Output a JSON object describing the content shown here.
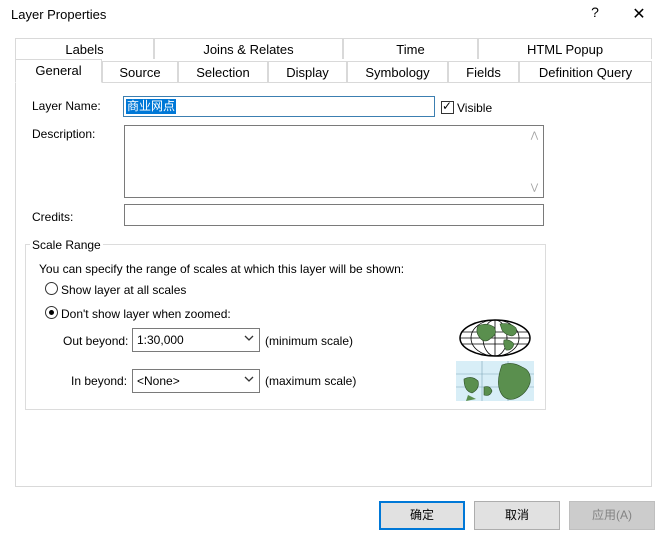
{
  "window": {
    "title": "Layer Properties",
    "help_glyph": "?",
    "close_glyph": "✕"
  },
  "tabs_row1": [
    "Labels",
    "Joins & Relates",
    "Time",
    "HTML Popup"
  ],
  "tabs_row2": [
    "General",
    "Source",
    "Selection",
    "Display",
    "Symbology",
    "Fields",
    "Definition Query"
  ],
  "active_tab": "General",
  "general": {
    "layer_name_label": "Layer Name:",
    "layer_name_value": "商业网点",
    "visible_label": "Visible",
    "visible_checked": true,
    "description_label": "Description:",
    "description_value": "",
    "credits_label": "Credits:",
    "credits_value": ""
  },
  "scale_range": {
    "title": "Scale Range",
    "intro": "You can specify the range of scales at which this layer will be shown:",
    "option_all": "Show layer at all scales",
    "option_zoomed": "Don't show layer when zoomed:",
    "selected_option": "option_zoomed",
    "out_beyond_label": "Out beyond:",
    "out_beyond_value": "1:30,000",
    "out_beyond_hint": "(minimum scale)",
    "in_beyond_label": "In beyond:",
    "in_beyond_value": "<None>",
    "in_beyond_hint": "(maximum scale)"
  },
  "buttons": {
    "ok": "确定",
    "cancel": "取消",
    "apply": "应用(A)"
  },
  "icons": {
    "globe": "globe-icon",
    "map": "map-zoom-icon",
    "chevron": "chevron-down-icon"
  }
}
